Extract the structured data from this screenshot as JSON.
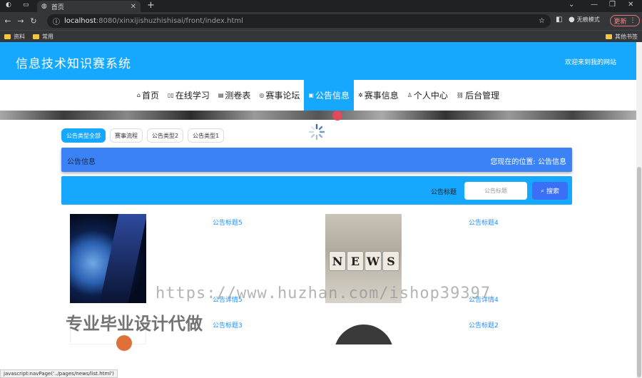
{
  "browser": {
    "tab_title": "首页",
    "url_host": "localhost",
    "url_path": ":8080/xinxijishuzhishisai/front/index.html",
    "profile": "无痕模式",
    "update_label": "更新",
    "bookmarks": [
      "资料",
      "常用"
    ],
    "other_bookmarks": "其他书签"
  },
  "header": {
    "title": "信息技术知识赛系统",
    "welcome": "欢迎来到我的网站"
  },
  "nav": {
    "items": [
      {
        "label": "首页",
        "icon": "home-icon"
      },
      {
        "label": "在线学习",
        "icon": "book-icon"
      },
      {
        "label": "测卷表",
        "icon": "list-icon"
      },
      {
        "label": "赛事论坛",
        "icon": "chat-icon"
      },
      {
        "label": "公告信息",
        "icon": "notice-icon",
        "active": true
      },
      {
        "label": "赛事信息",
        "icon": "gear-icon"
      },
      {
        "label": "个人中心",
        "icon": "user-icon"
      },
      {
        "label": "后台管理",
        "icon": "link-icon"
      }
    ],
    "accent_color": "#16a8ff"
  },
  "filters": [
    "公告类型全部",
    "赛事流程",
    "公告类型2",
    "公告类型1"
  ],
  "breadcrumb": {
    "section": "公告信息",
    "location_label": "您现在的位置:",
    "location_value": "公告信息"
  },
  "search": {
    "label": "公告标题",
    "placeholder": "公告标题",
    "button": "搜索"
  },
  "news": [
    {
      "title": "公告标题5",
      "detail": "公告详情5"
    },
    {
      "title": "公告标题4",
      "detail": "公告详情4"
    },
    {
      "title": "公告标题3"
    },
    {
      "title": "公告标题2"
    }
  ],
  "news_image_text": [
    "N",
    "E",
    "W",
    "S"
  ],
  "watermarks": {
    "url": "https://www.huzhan.com/ishop39397",
    "text": "专业毕业设计代做"
  },
  "status_bar": "javascript:navPage('../pages/news/list.html')"
}
